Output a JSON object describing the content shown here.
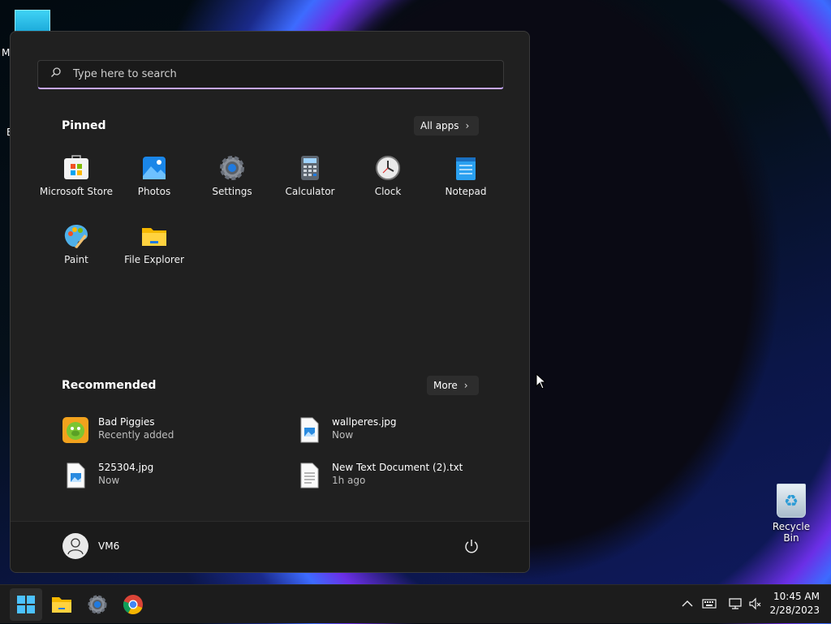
{
  "desktop": {
    "stub_labels": [
      "M",
      "E"
    ],
    "recycle_bin_label": "Recycle Bin"
  },
  "start_menu": {
    "search_placeholder": "Type here to search",
    "pinned_title": "Pinned",
    "all_apps_label": "All apps",
    "pinned_apps": [
      {
        "label": "Microsoft Store",
        "icon": "microsoft-store-icon"
      },
      {
        "label": "Photos",
        "icon": "photos-icon"
      },
      {
        "label": "Settings",
        "icon": "settings-gear-icon"
      },
      {
        "label": "Calculator",
        "icon": "calculator-icon"
      },
      {
        "label": "Clock",
        "icon": "clock-icon"
      },
      {
        "label": "Notepad",
        "icon": "notepad-icon"
      },
      {
        "label": "Paint",
        "icon": "paint-palette-icon"
      },
      {
        "label": "File Explorer",
        "icon": "folder-icon"
      }
    ],
    "recommended_title": "Recommended",
    "more_label": "More",
    "recommended": [
      {
        "name": "Bad Piggies",
        "sub": "Recently added",
        "icon": "bad-piggies-icon"
      },
      {
        "name": "wallperes.jpg",
        "sub": "Now",
        "icon": "image-file-icon"
      },
      {
        "name": "525304.jpg",
        "sub": "Now",
        "icon": "image-file-icon"
      },
      {
        "name": "New Text Document (2).txt",
        "sub": "1h ago",
        "icon": "text-file-icon"
      }
    ],
    "user_name": "VM6"
  },
  "taskbar": {
    "time": "10:45 AM",
    "date": "2/28/2023"
  },
  "colors": {
    "accent": "#c7a7ff",
    "menu_bg": "#202020",
    "taskbar_bg": "#1c1c1c"
  }
}
